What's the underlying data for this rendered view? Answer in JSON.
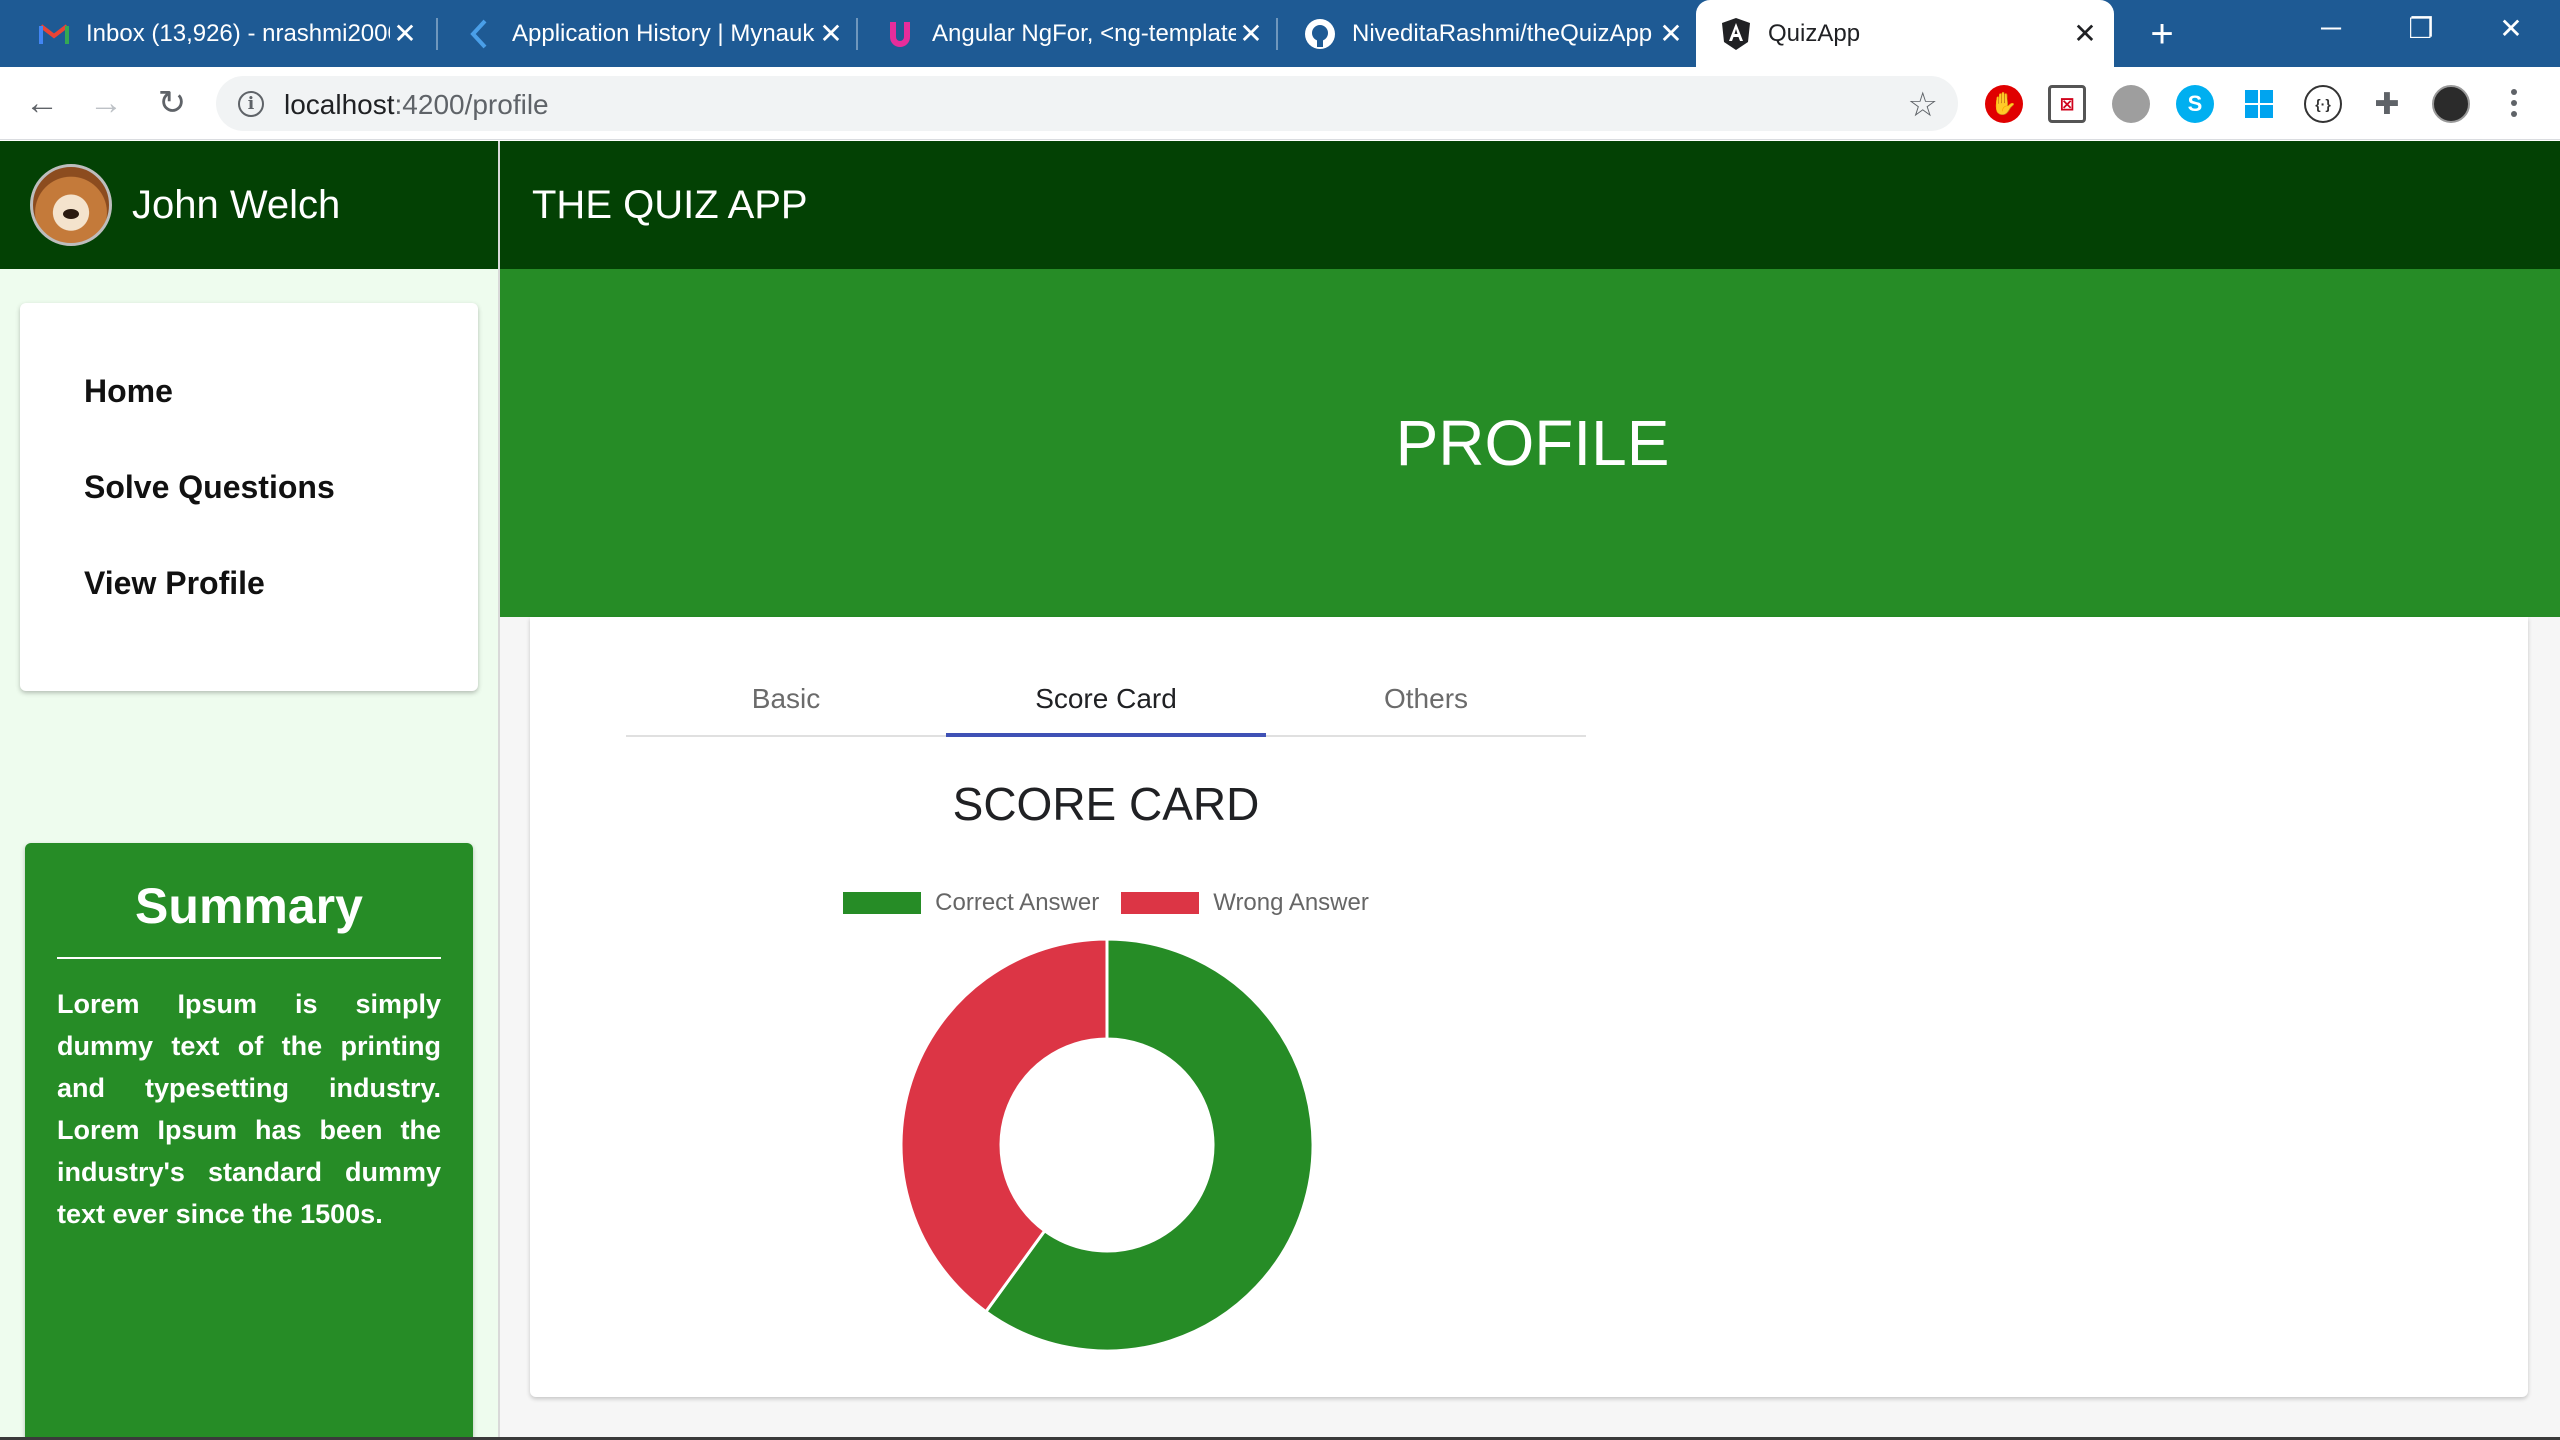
{
  "browser": {
    "tabs": [
      {
        "title": "Inbox (13,926) - nrashmi2000",
        "icon": "gmail-icon"
      },
      {
        "title": "Application History | Mynaukri",
        "icon": "kiwi-icon"
      },
      {
        "title": "Angular NgFor, <ng-template>",
        "icon": "ultimate-courses-icon"
      },
      {
        "title": "NiveditaRashmi/theQuizApp",
        "icon": "github-icon"
      },
      {
        "title": "QuizApp",
        "icon": "angular-icon"
      }
    ],
    "url_host": "localhost",
    "url_path": ":4200/profile"
  },
  "user": {
    "name": "John Welch"
  },
  "app": {
    "title": "THE QUIZ APP"
  },
  "nav": {
    "items": [
      "Home",
      "Solve Questions",
      "View Profile"
    ]
  },
  "summary": {
    "title": "Summary",
    "text": "Lorem Ipsum is simply dummy text of the printing and typesetting industry. Lorem Ipsum has been the industry's standard dummy text ever since the 1500s."
  },
  "page": {
    "title": "PROFILE"
  },
  "profile_tabs": [
    "Basic",
    "Score Card",
    "Others"
  ],
  "scorecard": {
    "title": "SCORE CARD"
  },
  "colors": {
    "correct": "#268c26",
    "wrong": "#dc3545",
    "header": "#034104",
    "banner": "#268c26"
  },
  "chart_data": {
    "type": "pie",
    "donut": true,
    "categories": [
      "Correct Answer",
      "Wrong Answer"
    ],
    "values": [
      60,
      40
    ],
    "colors": [
      "#268c26",
      "#dc3545"
    ],
    "legend": "top"
  }
}
